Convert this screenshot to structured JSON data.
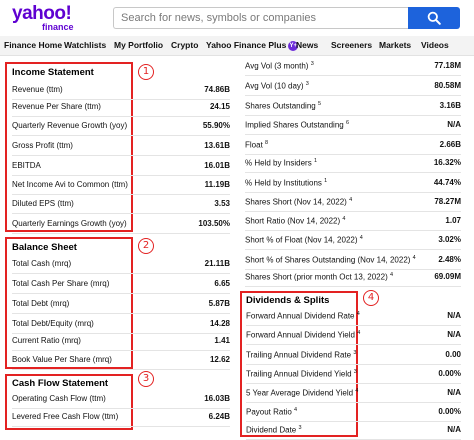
{
  "header": {
    "logo_line1": "yahoo!",
    "logo_line2": "finance",
    "search_placeholder": "Search for news, symbols or companies"
  },
  "nav": {
    "items": [
      "Finance Home",
      "Watchlists",
      "My Portfolio",
      "Crypto",
      "Yahoo Finance Plus",
      "News",
      "Screeners",
      "Markets",
      "Videos"
    ],
    "plus_badge": "Y+"
  },
  "left": {
    "income": {
      "badge": "1",
      "title": "Income Statement",
      "rows": [
        {
          "label": "Revenue (ttm)",
          "value": "74.86B"
        },
        {
          "label": "Revenue Per Share (ttm)",
          "value": "24.15"
        },
        {
          "label": "Quarterly Revenue Growth (yoy)",
          "value": "55.90%"
        },
        {
          "label": "Gross Profit (ttm)",
          "value": "13.61B"
        },
        {
          "label": "EBITDA",
          "value": "16.01B"
        },
        {
          "label": "Net Income Avi to Common (ttm)",
          "value": "11.19B"
        },
        {
          "label": "Diluted EPS (ttm)",
          "value": "3.53"
        },
        {
          "label": "Quarterly Earnings Growth (yoy)",
          "value": "103.50%"
        }
      ]
    },
    "balance": {
      "badge": "2",
      "title": "Balance Sheet",
      "rows": [
        {
          "label": "Total Cash (mrq)",
          "value": "21.11B"
        },
        {
          "label": "Total Cash Per Share (mrq)",
          "value": "6.65"
        },
        {
          "label": "Total Debt (mrq)",
          "value": "5.87B"
        },
        {
          "label": "Total Debt/Equity (mrq)",
          "value": "14.28"
        },
        {
          "label": "Current Ratio (mrq)",
          "value": "1.41"
        },
        {
          "label": "Book Value Per Share (mrq)",
          "value": "12.62"
        }
      ]
    },
    "cashflow": {
      "badge": "3",
      "title": "Cash Flow Statement",
      "rows": [
        {
          "label": "Operating Cash Flow (ttm)",
          "value": "16.03B"
        },
        {
          "label": "Levered Free Cash Flow (ttm)",
          "value": "6.24B"
        }
      ]
    }
  },
  "right": {
    "stats": [
      {
        "label": "Avg Vol (3 month)",
        "sup": "3",
        "value": "77.18M"
      },
      {
        "label": "Avg Vol (10 day)",
        "sup": "3",
        "value": "80.58M"
      },
      {
        "label": "Shares Outstanding",
        "sup": "5",
        "value": "3.16B"
      },
      {
        "label": "Implied Shares Outstanding",
        "sup": "6",
        "value": "N/A"
      },
      {
        "label": "Float",
        "sup": "8",
        "value": "2.66B"
      },
      {
        "label": "% Held by Insiders",
        "sup": "1",
        "value": "16.32%"
      },
      {
        "label": "% Held by Institutions",
        "sup": "1",
        "value": "44.74%"
      },
      {
        "label": "Shares Short (Nov 14, 2022)",
        "sup": "4",
        "value": "78.27M"
      },
      {
        "label": "Short Ratio (Nov 14, 2022)",
        "sup": "4",
        "value": "1.07"
      },
      {
        "label": "Short % of Float (Nov 14, 2022)",
        "sup": "4",
        "value": "3.02%"
      },
      {
        "label": "Short % of Shares Outstanding (Nov 14, 2022)",
        "sup": "4",
        "value": "2.48%"
      },
      {
        "label": "Shares Short (prior month Oct 13, 2022)",
        "sup": "4",
        "value": "69.09M"
      }
    ],
    "dividends": {
      "badge": "4",
      "title": "Dividends & Splits",
      "rows": [
        {
          "label": "Forward Annual Dividend Rate",
          "sup": "4",
          "value": "N/A"
        },
        {
          "label": "Forward Annual Dividend Yield",
          "sup": "4",
          "value": "N/A"
        },
        {
          "label": "Trailing Annual Dividend Rate",
          "sup": "3",
          "value": "0.00"
        },
        {
          "label": "Trailing Annual Dividend Yield",
          "sup": "3",
          "value": "0.00%"
        },
        {
          "label": "5 Year Average Dividend Yield",
          "sup": "4",
          "value": "N/A"
        },
        {
          "label": "Payout Ratio",
          "sup": "4",
          "value": "0.00%"
        },
        {
          "label": "Dividend Date",
          "sup": "3",
          "value": "N/A"
        }
      ]
    }
  },
  "colors": {
    "accent": "#5f01d1",
    "search_button": "#1d63dc",
    "highlight": "#e32222"
  }
}
